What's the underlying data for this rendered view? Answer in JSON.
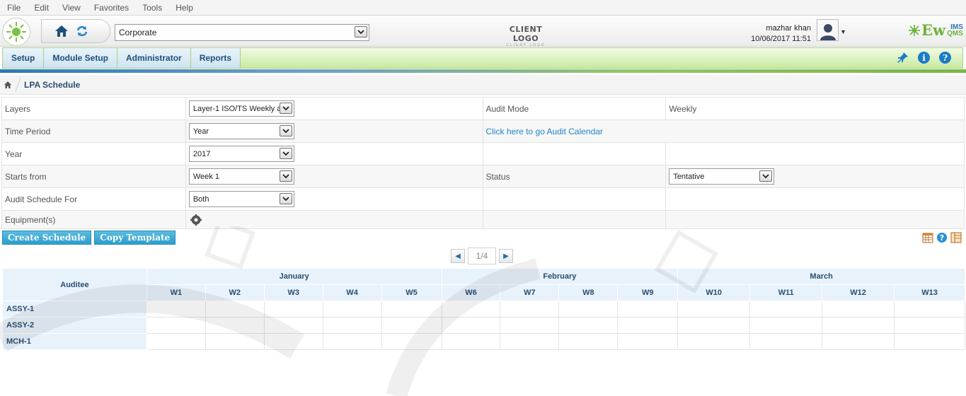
{
  "menu": [
    "File",
    "Edit",
    "View",
    "Favorites",
    "Tools",
    "Help"
  ],
  "header": {
    "organization": "Corporate",
    "client_logo_main": "CLIENT LOGO",
    "client_logo_sub": "CLIENT LOGO",
    "user_name": "mazhar khan",
    "datetime": "10/06/2017 11:51",
    "brand_ew": "Ew",
    "brand_ims": "IMS",
    "brand_qms": "QMS"
  },
  "nav": {
    "tabs": [
      "Setup",
      "Module Setup",
      "Administrator",
      "Reports"
    ],
    "info_glyph": "i",
    "help_glyph": "?"
  },
  "breadcrumb": {
    "title": "LPA Schedule"
  },
  "form": {
    "layers_label": "Layers",
    "layers_value": "Layer-1 ISO/TS Weekly a",
    "audit_mode_label": "Audit Mode",
    "audit_mode_value": "Weekly",
    "time_period_label": "Time Period",
    "time_period_value": "Year",
    "calendar_link": "Click here to go Audit Calendar",
    "year_label": "Year",
    "year_value": "2017",
    "starts_from_label": "Starts from",
    "starts_from_value": "Week 1",
    "status_label": "Status",
    "status_value": "Tentative",
    "schedule_for_label": "Audit Schedule For",
    "schedule_for_value": "Both",
    "equipment_label": "Equipment(s)"
  },
  "buttons": {
    "create": "Create Schedule",
    "copy": "Copy Template"
  },
  "pager": {
    "count": "1/4"
  },
  "schedule": {
    "auditee_header": "Auditee",
    "months": [
      {
        "name": "January",
        "span": 5
      },
      {
        "name": "February",
        "span": 4
      },
      {
        "name": "March",
        "span": 4
      }
    ],
    "weeks": [
      "W1",
      "W2",
      "W3",
      "W4",
      "W5",
      "W6",
      "W7",
      "W8",
      "W9",
      "W10",
      "W11",
      "W12",
      "W13"
    ],
    "auditees": [
      "ASSY-1",
      "ASSY-2",
      "MCH-1"
    ]
  },
  "colors": {
    "accent": "#1f85c8",
    "nav_green": "#c8eaa0",
    "button_blue": "#2b9dcb"
  }
}
